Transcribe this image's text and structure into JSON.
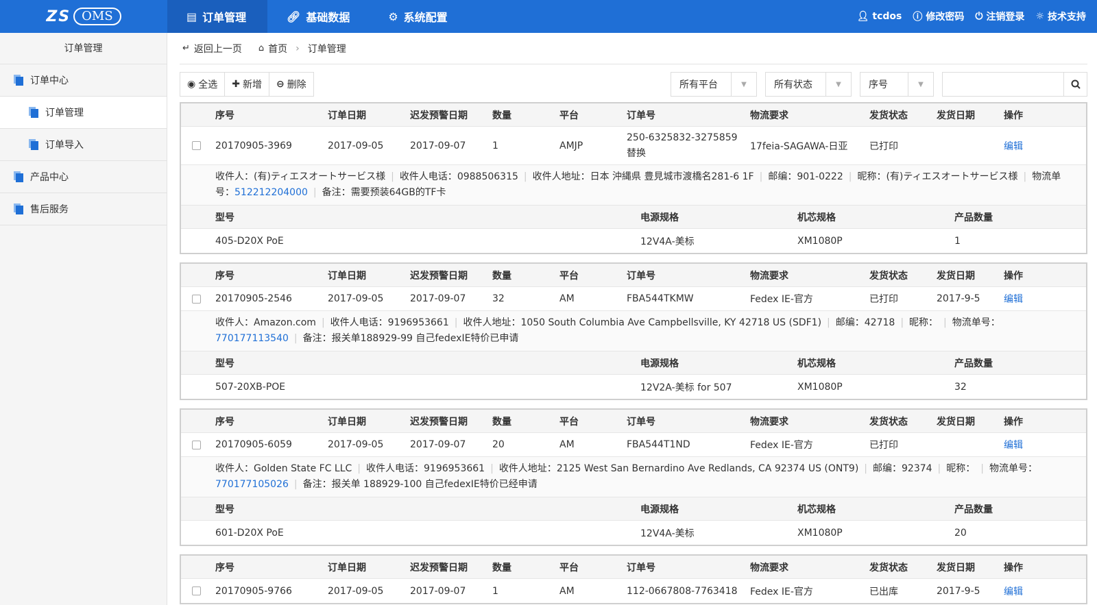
{
  "app": {
    "logo_zs": "ZS",
    "logo_oms": "OMS"
  },
  "topnav": {
    "order_mgmt": "订单管理",
    "base_data": "基础数据",
    "sys_config": "系统配置"
  },
  "topright": {
    "user": "tcdos",
    "change_pwd": "修改密码",
    "logout": "注销登录",
    "support": "技术支持"
  },
  "sidebar": {
    "title": "订单管理",
    "items": [
      {
        "label": "订单中心"
      },
      {
        "label": "订单管理"
      },
      {
        "label": "订单导入"
      },
      {
        "label": "产品中心"
      },
      {
        "label": "售后服务"
      }
    ]
  },
  "breadcrumb": {
    "back": "返回上一页",
    "home": "首页",
    "current": "订单管理"
  },
  "toolbar": {
    "select_all": "全选",
    "add": "新增",
    "delete": "删除"
  },
  "filters": {
    "platform": "所有平台",
    "status": "所有状态",
    "sort": "序号",
    "search_placeholder": ""
  },
  "headers": {
    "seq": "序号",
    "date": "订单日期",
    "warn": "迟发预警日期",
    "qty": "数量",
    "platform": "平台",
    "order_no": "订单号",
    "shipping": "物流要求",
    "ship_status": "发货状态",
    "ship_date": "发货日期",
    "op": "操作",
    "model": "型号",
    "power": "电源规格",
    "chip": "机芯规格",
    "prod_qty": "产品数量"
  },
  "info_labels": {
    "recipient": "收件人：",
    "phone": "收件人电话：",
    "address": "收件人地址：",
    "zip": "邮编：",
    "nickname": "昵称：",
    "tracking": "物流单号：",
    "note": "备注："
  },
  "edit_label": "编辑",
  "orders": [
    {
      "seq": "20170905-3969",
      "date": "2017-09-05",
      "warn": "2017-09-07",
      "qty": "1",
      "platform": "AMJP",
      "order_no": "250-6325832-3275859 替换",
      "shipping": "17feia-SAGAWA-日亚",
      "ship_status": "已打印",
      "ship_date": "",
      "recipient": "(有)ティエスオートサービス様",
      "phone": "0988506315",
      "address": "日本 沖縄県 豊見城市渡橋名281-6 1F",
      "zip": "901-0222",
      "nickname": "(有)ティエスオートサービス様",
      "tracking": "512212204000",
      "note": "需要预装64GB的TF卡",
      "model": "405-D20X PoE",
      "power": "12V4A-美标",
      "chip": "XM1080P",
      "prod_qty": "1"
    },
    {
      "seq": "20170905-2546",
      "date": "2017-09-05",
      "warn": "2017-09-07",
      "qty": "32",
      "platform": "AM",
      "order_no": "FBA544TKMW",
      "shipping": "Fedex IE-官方",
      "ship_status": "已打印",
      "ship_date": "2017-9-5",
      "recipient": "Amazon.com",
      "phone": "9196953661",
      "address": "1050 South Columbia Ave Campbellsville, KY 42718 US (SDF1)",
      "zip": "42718",
      "nickname": "",
      "tracking": "770177113540",
      "note": "报关单188929-99 自己fedexIE特价已申请",
      "model": "507-20XB-POE",
      "power": "12V2A-美标 for 507",
      "chip": "XM1080P",
      "prod_qty": "32"
    },
    {
      "seq": "20170905-6059",
      "date": "2017-09-05",
      "warn": "2017-09-07",
      "qty": "20",
      "platform": "AM",
      "order_no": "FBA544T1ND",
      "shipping": "Fedex IE-官方",
      "ship_status": "已打印",
      "ship_date": "",
      "recipient": "Golden State FC LLC",
      "phone": "9196953661",
      "address": "2125 West San Bernardino Ave Redlands, CA 92374 US (ONT9)",
      "zip": "92374",
      "nickname": "",
      "tracking": "770177105026",
      "note": "报关单 188929-100 自己fedexIE特价已经申请",
      "model": "601-D20X PoE",
      "power": "12V4A-美标",
      "chip": "XM1080P",
      "prod_qty": "20"
    },
    {
      "seq": "20170905-9766",
      "date": "2017-09-05",
      "warn": "2017-09-07",
      "qty": "1",
      "platform": "AM",
      "order_no": "112-0667808-7763418",
      "shipping": "Fedex IE-官方",
      "ship_status": "已出库",
      "ship_date": "2017-9-5"
    }
  ]
}
